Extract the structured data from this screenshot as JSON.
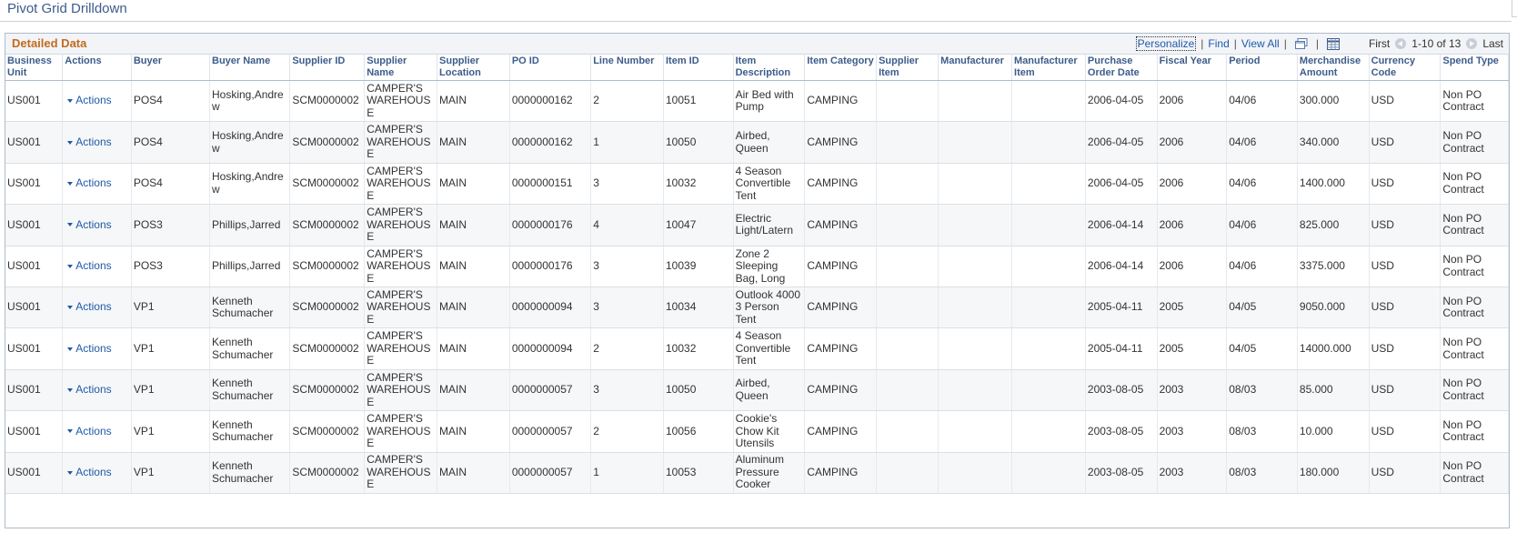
{
  "page": {
    "title": "Pivot Grid Drilldown"
  },
  "grid": {
    "title": "Detailed Data",
    "nav": {
      "personalize": "Personalize",
      "find": "Find",
      "view_all": "View All",
      "first": "First",
      "range": "1-10 of 13",
      "last": "Last",
      "sep": "|"
    },
    "columns": [
      "Business Unit",
      "Actions",
      "Buyer",
      "Buyer Name",
      "Supplier ID",
      "Supplier Name",
      "Supplier Location",
      "PO ID",
      "Line Number",
      "Item ID",
      "Item Description",
      "Item Category",
      "Supplier Item",
      "Manufacturer",
      "Manufacturer Item",
      "Purchase Order Date",
      "Fiscal Year",
      "Period",
      "Merchandise Amount",
      "Currency Code",
      "Spend Type"
    ],
    "action_label": "Actions",
    "rows": [
      [
        "US001",
        "Actions",
        "POS4",
        "Hosking,Andrew",
        "SCM0000002",
        "CAMPER'S WAREHOUSE",
        "MAIN",
        "0000000162",
        "2",
        "10051",
        "Air Bed with Pump",
        "CAMPING",
        "",
        "",
        "",
        "2006-04-05",
        "2006",
        "04/06",
        "300.000",
        "USD",
        "Non PO Contract"
      ],
      [
        "US001",
        "Actions",
        "POS4",
        "Hosking,Andrew",
        "SCM0000002",
        "CAMPER'S WAREHOUSE",
        "MAIN",
        "0000000162",
        "1",
        "10050",
        "Airbed, Queen",
        "CAMPING",
        "",
        "",
        "",
        "2006-04-05",
        "2006",
        "04/06",
        "340.000",
        "USD",
        "Non PO Contract"
      ],
      [
        "US001",
        "Actions",
        "POS4",
        "Hosking,Andrew",
        "SCM0000002",
        "CAMPER'S WAREHOUSE",
        "MAIN",
        "0000000151",
        "3",
        "10032",
        "4 Season Convertible Tent",
        "CAMPING",
        "",
        "",
        "",
        "2006-04-05",
        "2006",
        "04/06",
        "1400.000",
        "USD",
        "Non PO Contract"
      ],
      [
        "US001",
        "Actions",
        "POS3",
        "Phillips,Jarred",
        "SCM0000002",
        "CAMPER'S WAREHOUSE",
        "MAIN",
        "0000000176",
        "4",
        "10047",
        "Electric Light/Latern",
        "CAMPING",
        "",
        "",
        "",
        "2006-04-14",
        "2006",
        "04/06",
        "825.000",
        "USD",
        "Non PO Contract"
      ],
      [
        "US001",
        "Actions",
        "POS3",
        "Phillips,Jarred",
        "SCM0000002",
        "CAMPER'S WAREHOUSE",
        "MAIN",
        "0000000176",
        "3",
        "10039",
        "Zone 2 Sleeping Bag, Long",
        "CAMPING",
        "",
        "",
        "",
        "2006-04-14",
        "2006",
        "04/06",
        "3375.000",
        "USD",
        "Non PO Contract"
      ],
      [
        "US001",
        "Actions",
        "VP1",
        "Kenneth Schumacher",
        "SCM0000002",
        "CAMPER'S WAREHOUSE",
        "MAIN",
        "0000000094",
        "3",
        "10034",
        "Outlook 4000 3 Person Tent",
        "CAMPING",
        "",
        "",
        "",
        "2005-04-11",
        "2005",
        "04/05",
        "9050.000",
        "USD",
        "Non PO Contract"
      ],
      [
        "US001",
        "Actions",
        "VP1",
        "Kenneth Schumacher",
        "SCM0000002",
        "CAMPER'S WAREHOUSE",
        "MAIN",
        "0000000094",
        "2",
        "10032",
        "4 Season Convertible Tent",
        "CAMPING",
        "",
        "",
        "",
        "2005-04-11",
        "2005",
        "04/05",
        "14000.000",
        "USD",
        "Non PO Contract"
      ],
      [
        "US001",
        "Actions",
        "VP1",
        "Kenneth Schumacher",
        "SCM0000002",
        "CAMPER'S WAREHOUSE",
        "MAIN",
        "0000000057",
        "3",
        "10050",
        "Airbed, Queen",
        "CAMPING",
        "",
        "",
        "",
        "2003-08-05",
        "2003",
        "08/03",
        "85.000",
        "USD",
        "Non PO Contract"
      ],
      [
        "US001",
        "Actions",
        "VP1",
        "Kenneth Schumacher",
        "SCM0000002",
        "CAMPER'S WAREHOUSE",
        "MAIN",
        "0000000057",
        "2",
        "10056",
        "Cookie's Chow Kit Utensils",
        "CAMPING",
        "",
        "",
        "",
        "2003-08-05",
        "2003",
        "08/03",
        "10.000",
        "USD",
        "Non PO Contract"
      ],
      [
        "US001",
        "Actions",
        "VP1",
        "Kenneth Schumacher",
        "SCM0000002",
        "CAMPER'S WAREHOUSE",
        "MAIN",
        "0000000057",
        "1",
        "10053",
        "Aluminum Pressure Cooker",
        "CAMPING",
        "",
        "",
        "",
        "2003-08-05",
        "2003",
        "08/03",
        "180.000",
        "USD",
        "Non PO Contract"
      ]
    ]
  },
  "icons": {
    "zoom": "new-window-icon",
    "download": "download-to-spreadsheet-icon",
    "prev": "previous-arrow-icon",
    "next": "next-arrow-icon",
    "actions": "caret-down-icon"
  },
  "colors": {
    "link": "#1f5aa8",
    "header_text": "#3c5c8c",
    "grid_title": "#c26b1c"
  }
}
